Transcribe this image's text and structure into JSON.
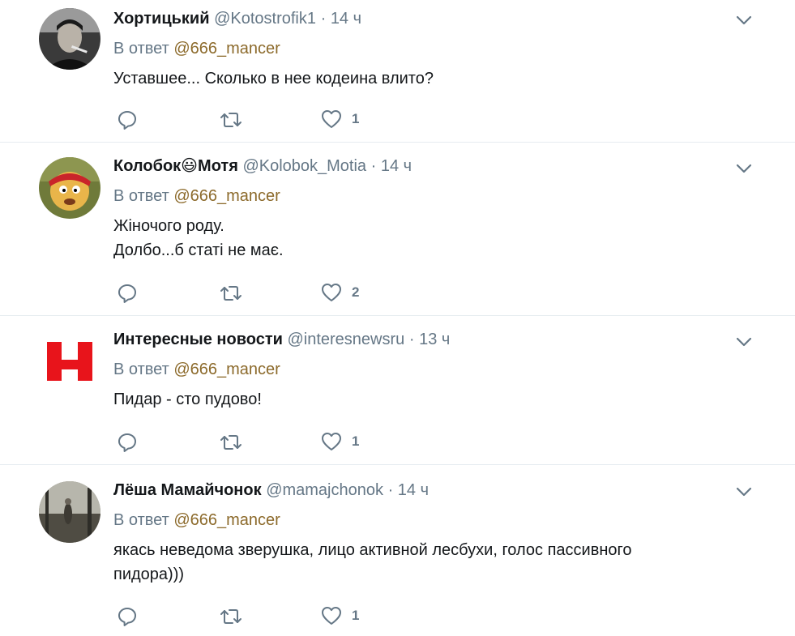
{
  "reply_prefix": "В ответ",
  "tweets": [
    {
      "name": "Хортицький",
      "handle": "@Kotostrofik1",
      "sep": "·",
      "time": "14 ч",
      "reply_to": "@666_mancer",
      "text_lines": [
        "Уставшее... Сколько в нее кодеина влито?"
      ],
      "likes": "1"
    },
    {
      "name_part1": "Колобок",
      "name_emoji": "😃",
      "name_part2": "Мотя",
      "handle": "@Kolobok_Motia",
      "sep": "·",
      "time": "14 ч",
      "reply_to": "@666_mancer",
      "text_lines": [
        "Жіночого роду.",
        "Долбо...б статі не має."
      ],
      "likes": "2"
    },
    {
      "name": "Интересные новости",
      "handle": "@interesnewsru",
      "sep": "·",
      "time": "13 ч",
      "reply_to": "@666_mancer",
      "text_lines": [
        "Пидар - сто пудово!"
      ],
      "likes": "1"
    },
    {
      "name": "Лёша Мамайчонок",
      "handle": "@mamajchonok",
      "sep": "·",
      "time": "14 ч",
      "reply_to": "@666_mancer",
      "text_lines": [
        "якась неведома зверушка, лицо активной лесбухи, голос пассивного",
        "пидора)))"
      ],
      "likes": "1"
    }
  ],
  "colors": {
    "name": "#14171a",
    "secondary": "#657786",
    "reply_link": "#8c6a2b",
    "divider": "#e6ecf0",
    "news_logo_red": "#e8141b"
  },
  "icons": {
    "menu": "chevron-down-icon",
    "reply": "reply-bubble-icon",
    "retweet": "retweet-icon",
    "like": "heart-icon"
  }
}
